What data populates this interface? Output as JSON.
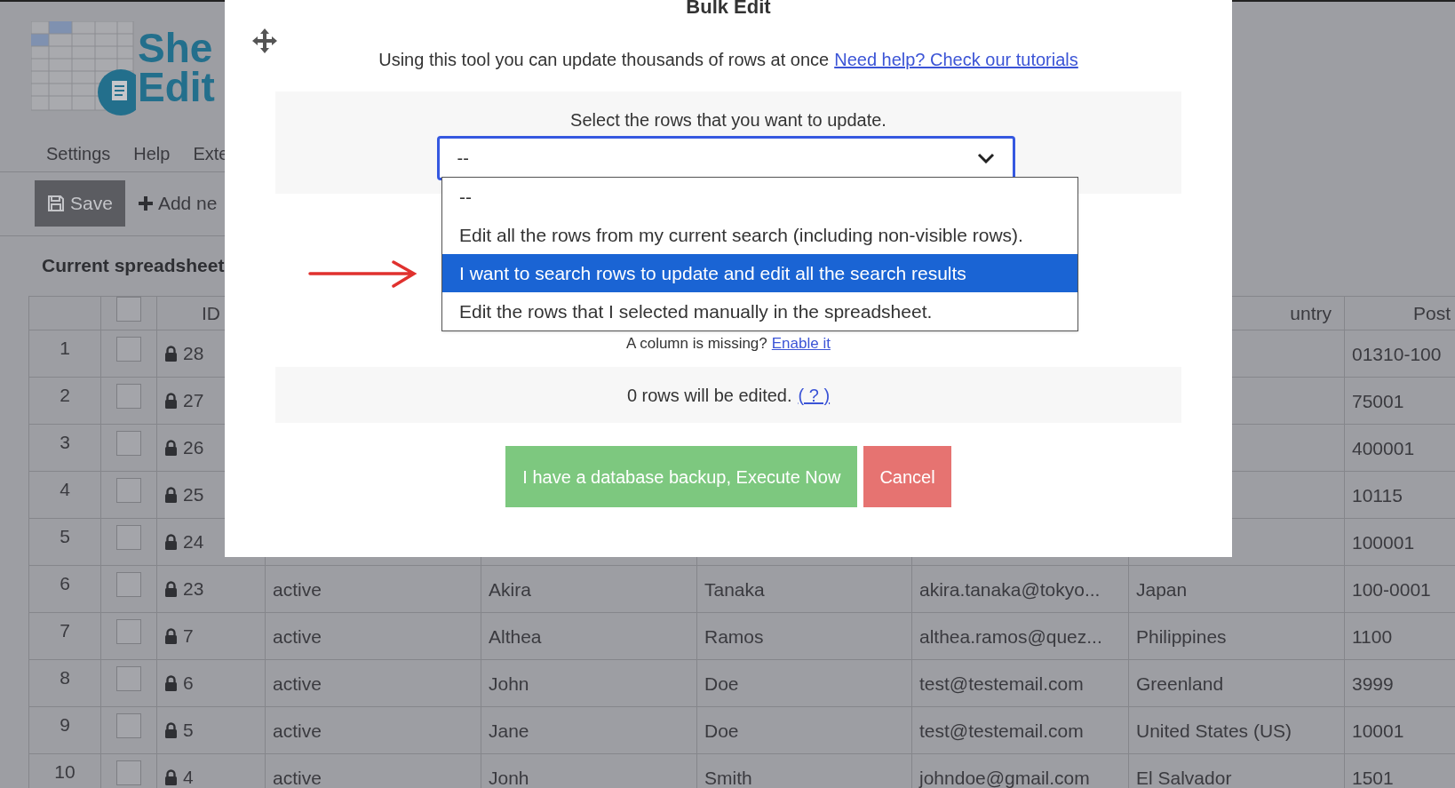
{
  "app": {
    "logo_text": [
      "She",
      "Edit"
    ],
    "menu": [
      "Settings",
      "Help",
      "Exte"
    ],
    "toolbar": [
      {
        "label": "Save",
        "kind": "save"
      },
      {
        "label": "Add ne",
        "kind": "add"
      }
    ],
    "heading": "Current spreadsheet"
  },
  "table": {
    "header": {
      "checked": false,
      "id": "ID",
      "column_8": "untry",
      "column_9": "Post"
    },
    "rows": [
      {
        "number": "1",
        "checked": false,
        "id": "28",
        "postcode": "01310-100"
      },
      {
        "number": "2",
        "checked": false,
        "id": "27",
        "postcode": "75001"
      },
      {
        "number": "3",
        "checked": false,
        "id": "26",
        "postcode": "400001"
      },
      {
        "number": "4",
        "checked": false,
        "id": "25",
        "postcode": "10115"
      },
      {
        "number": "5",
        "checked": false,
        "id": "24",
        "postcode": "100001"
      },
      {
        "number": "6",
        "checked": false,
        "id": "23",
        "status": "active",
        "first_name": "Akira",
        "last_name": "Tanaka",
        "email": "akira.tanaka@tokyo...",
        "country": "Japan",
        "postcode": "100-0001"
      },
      {
        "number": "7",
        "checked": false,
        "id": "7",
        "status": "active",
        "first_name": "Althea",
        "last_name": "Ramos",
        "email": "althea.ramos@quez...",
        "country": "Philippines",
        "postcode": "1100"
      },
      {
        "number": "8",
        "checked": false,
        "id": "6",
        "status": "active",
        "first_name": "John",
        "last_name": "Doe",
        "email": "test@testemail.com",
        "country": "Greenland",
        "postcode": "3999"
      },
      {
        "number": "9",
        "checked": false,
        "id": "5",
        "status": "active",
        "first_name": "Jane",
        "last_name": "Doe",
        "email": "test@testemail.com",
        "country": "United States (US)",
        "postcode": "10001"
      },
      {
        "number": "10",
        "checked": false,
        "id": "4",
        "status": "active",
        "first_name": "Jonh",
        "last_name": "Smith",
        "email": "johndoe@gmail.com",
        "country": "El Salvador",
        "postcode": "1501"
      }
    ]
  },
  "modal": {
    "title": "Bulk Edit",
    "intro": "Using this tool you can update thousands of rows at once",
    "help_link": "Need help? Check our tutorials",
    "select_label": "Select the rows that you want to update.",
    "select_value": "--",
    "expanded": true,
    "options": [
      {
        "label": "--",
        "selected": false
      },
      {
        "label": "Edit all the rows from my current search (including non-visible rows).",
        "selected": false
      },
      {
        "label": "I want to search rows to update and edit all the search results",
        "selected": true
      },
      {
        "label": "Edit the rows that I selected manually in the spreadsheet.",
        "selected": false
      }
    ],
    "missing_note": "A column is missing?",
    "enable_link": "Enable it",
    "count_text": "0 rows will be edited.",
    "count_help": "( ? )",
    "buttons": [
      {
        "label": "I have a database backup, Execute Now",
        "kind": "primary"
      },
      {
        "label": "Cancel",
        "kind": "cancel"
      }
    ]
  }
}
